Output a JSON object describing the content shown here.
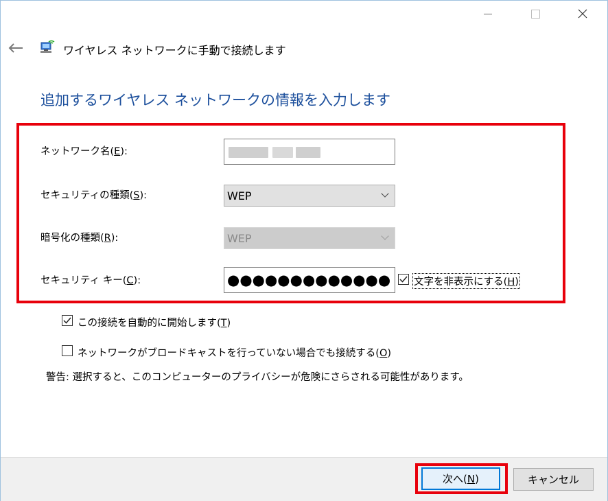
{
  "window": {
    "title": "ワイヤレス ネットワークに手動で接続します"
  },
  "titlebar": {
    "icons": [
      "minimize-icon",
      "maximize-icon",
      "close-icon"
    ]
  },
  "header": {
    "back_icon": "back-arrow-icon",
    "network_icon": "wireless-network-icon"
  },
  "page": {
    "heading": "追加するワイヤレス ネットワークの情報を入力します"
  },
  "form": {
    "network_name_label": "ネットワーク名(",
    "network_name_accel": "E",
    "network_name_label_end": "):",
    "security_type_label": "セキュリティの種類(",
    "security_type_accel": "S",
    "security_type_label_end": "):",
    "security_type_value": "WEP",
    "encryption_type_label": "暗号化の種類(",
    "encryption_type_accel": "R",
    "encryption_type_label_end": "):",
    "encryption_type_value": "WEP",
    "security_key_label": "セキュリティ キー(",
    "security_key_accel": "C",
    "security_key_label_end": "):",
    "security_key_masked": "●●●●●●●●●●●●●",
    "hide_chars_label": "文字を非表示にする(",
    "hide_chars_accel": "H",
    "hide_chars_label_end": ")"
  },
  "options": {
    "auto_connect_label": "この接続を自動的に開始します(",
    "auto_connect_accel": "T",
    "auto_connect_label_end": ")",
    "connect_hidden_label": "ネットワークがブロードキャストを行っていない場合でも接続する(",
    "connect_hidden_accel": "O",
    "connect_hidden_label_end": ")",
    "warning": "警告: 選択すると、このコンピューターのプライバシーが危険にさらされる可能性があります。"
  },
  "footer": {
    "next_label": "次へ(",
    "next_accel": "N",
    "next_label_end": ")",
    "cancel_label": "キャンセル"
  },
  "colors": {
    "heading": "#1c4f9c",
    "highlight": "#e8000b",
    "accent": "#0078d7"
  }
}
